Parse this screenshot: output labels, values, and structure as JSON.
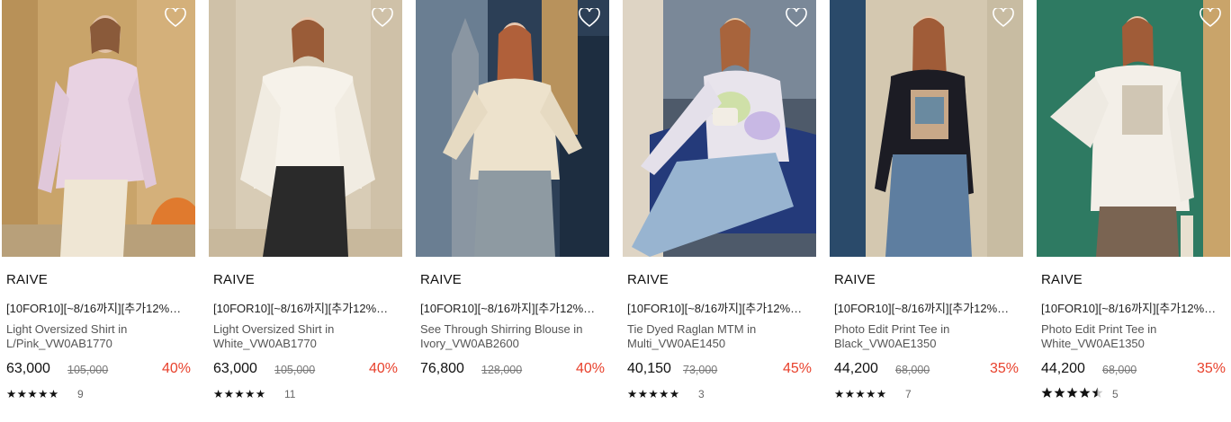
{
  "icons": {
    "wishlist": "heart-outline-icon",
    "star": "star-icon"
  },
  "colors": {
    "discount": "#e8412c",
    "price": "#111111",
    "text_muted": "#555555"
  },
  "products": [
    {
      "brand": "RAIVE",
      "promo": "[10FOR10][~8/16까지][추가12%…",
      "name": "Light Oversized Shirt in L/Pink_VW0AB1770",
      "price": "63,000",
      "original_price": "105,000",
      "discount": "40%",
      "rating_stars": "★★★★★",
      "rating": 5,
      "review_count": "9"
    },
    {
      "brand": "RAIVE",
      "promo": "[10FOR10][~8/16까지][추가12%…",
      "name": "Light Oversized Shirt in White_VW0AB1770",
      "price": "63,000",
      "original_price": "105,000",
      "discount": "40%",
      "rating_stars": "★★★★★",
      "rating": 5,
      "review_count": "11"
    },
    {
      "brand": "RAIVE",
      "promo": "[10FOR10][~8/16까지][추가12%…",
      "name": "See Through Shirring Blouse in Ivory_VW0AB2600",
      "price": "76,800",
      "original_price": "128,000",
      "discount": "40%",
      "rating_stars": "",
      "rating": 0,
      "review_count": ""
    },
    {
      "brand": "RAIVE",
      "promo": "[10FOR10][~8/16까지][추가12%…",
      "name": "Tie Dyed Raglan MTM in Multi_VW0AE1450",
      "price": "40,150",
      "original_price": "73,000",
      "discount": "45%",
      "rating_stars": "★★★★★",
      "rating": 5,
      "review_count": "3"
    },
    {
      "brand": "RAIVE",
      "promo": "[10FOR10][~8/16까지][추가12%…",
      "name": "Photo Edit Print Tee in Black_VW0AE1350",
      "price": "44,200",
      "original_price": "68,000",
      "discount": "35%",
      "rating_stars": "★★★★★",
      "rating": 5,
      "review_count": "7"
    },
    {
      "brand": "RAIVE",
      "promo": "[10FOR10][~8/16까지][추가12%…",
      "name": "Photo Edit Print Tee in White_VW0AE1350",
      "price": "44,200",
      "original_price": "68,000",
      "discount": "35%",
      "rating_stars": "★★★★★",
      "rating": 4.5,
      "review_count": "5"
    }
  ]
}
